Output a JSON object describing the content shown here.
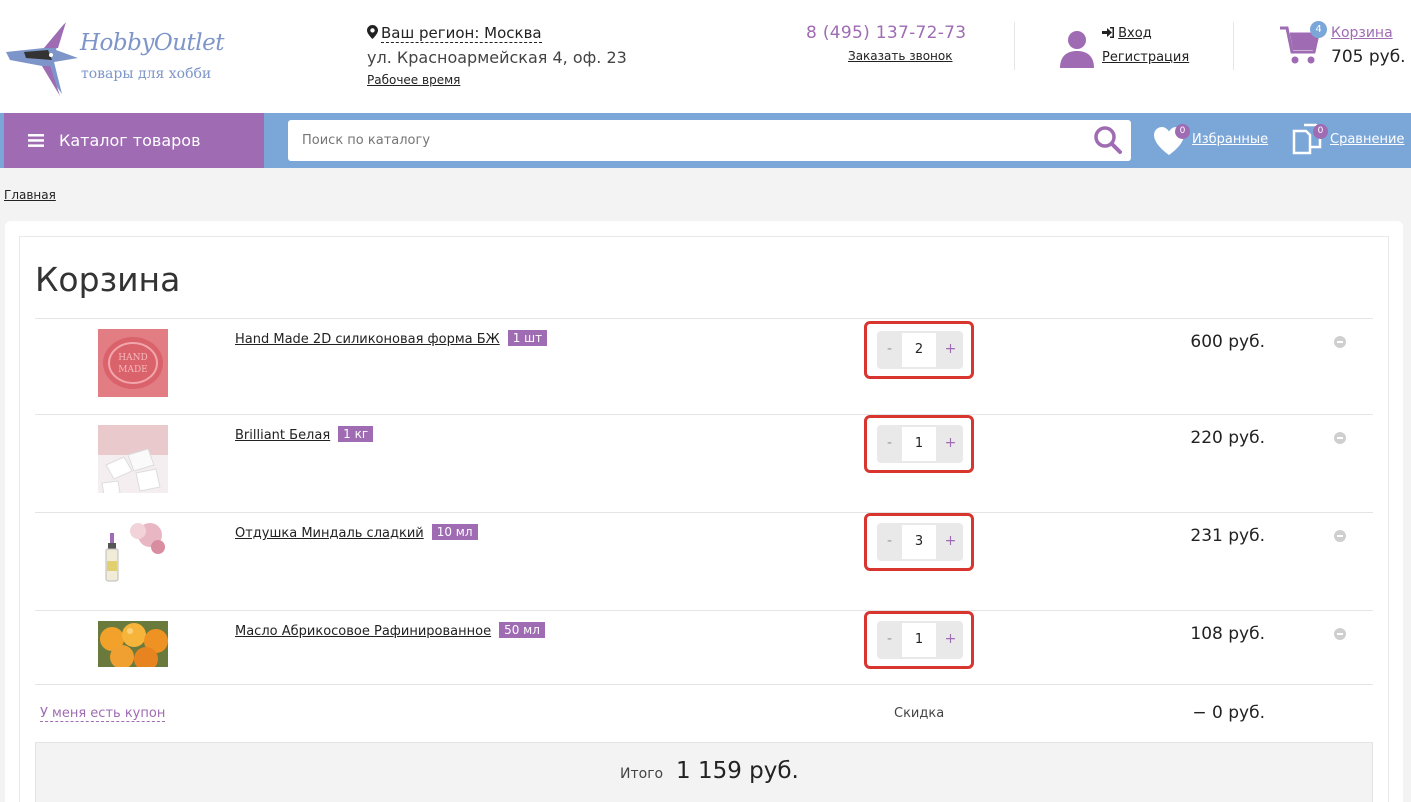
{
  "header": {
    "logo_name": "HobbyOutlet",
    "logo_tagline": "товары для хобби",
    "region_label": "Ваш регион: Москва",
    "address": "ул. Красноармейская 4, оф. 23",
    "work_time": "Рабочее время",
    "phone": "8 (495) 137-72-73",
    "callback": "Заказать звонок",
    "login": "Вход",
    "register": "Регистрация",
    "cart_count": "4",
    "cart_label": "Корзина",
    "cart_sum": "705 руб."
  },
  "nav": {
    "catalog": "Каталог товаров",
    "search_placeholder": "Поиск по каталогу",
    "favorites_count": "0",
    "favorites": "Избранные",
    "compare_count": "0",
    "compare": "Сравнение"
  },
  "breadcrumb": "Главная",
  "page_title": "Корзина",
  "items": [
    {
      "name": "Hand Made 2D силиконовая форма БЖ",
      "pack": "1 шт",
      "qty": "2",
      "price": "600 руб."
    },
    {
      "name": "Brilliant Белая",
      "pack": "1 кг",
      "qty": "1",
      "price": "220 руб."
    },
    {
      "name": "Отдушка Миндаль сладкий",
      "pack": "10 мл",
      "qty": "3",
      "price": "231 руб."
    },
    {
      "name": "Масло Абрикосовое Рафинированное",
      "pack": "50 мл",
      "qty": "1",
      "price": "108 руб."
    }
  ],
  "qty_controls": {
    "minus": "-",
    "plus": "+"
  },
  "summary": {
    "coupon": "У меня есть купон",
    "discount_label": "Скидка",
    "discount_value": "− 0 руб.",
    "total_label": "Итого",
    "total_value": "1 159 руб."
  },
  "colors": {
    "accent_purple": "#9f6bb3",
    "nav_blue": "#7aa6d8",
    "highlight_red": "#d9352f"
  }
}
